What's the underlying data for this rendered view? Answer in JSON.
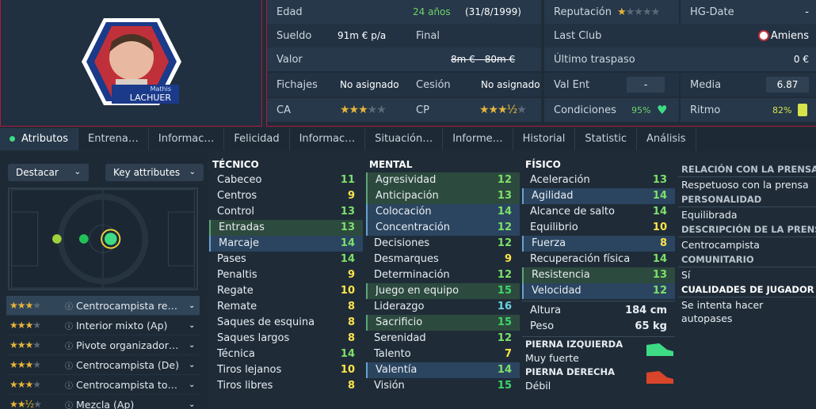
{
  "player": {
    "first": "Mathis",
    "last": "LACHUER"
  },
  "info": {
    "age_label": "Edad",
    "age": "24 años",
    "birth": "(31/8/1999)",
    "wage_label": "Sueldo",
    "wage": "91m € p/a",
    "final_label": "Final",
    "value_label": "Valor",
    "value": "8m € - 80m €",
    "signings_label": "Fichajes",
    "signings": "No asignado",
    "cesion_label": "Cesión",
    "cesion": "No asignado",
    "ca_label": "CA",
    "cp_label": "CP",
    "rep_label": "Reputación",
    "hg_label": "HG-Date",
    "hg": "-",
    "lastclub_label": "Last Club",
    "lastclub": "Amiens",
    "transfer_label": "Último traspaso",
    "transfer": "0 €",
    "valent_label": "Val Ent",
    "valent": "-",
    "media_label": "Media",
    "media": "6.87",
    "cond_label": "Condiciones",
    "cond": "95%",
    "ritmo_label": "Ritmo",
    "ritmo": "82%"
  },
  "tabs": [
    "Atributos",
    "Entrena…",
    "Informac…",
    "Felicidad",
    "Informac…",
    "Situación…",
    "Informe…",
    "Historial",
    "Statistic",
    "Análisis"
  ],
  "left": {
    "highlight": "Destacar",
    "key": "Key attributes"
  },
  "roles": [
    {
      "name": "Centrocampista re…",
      "stars": 3,
      "half": false
    },
    {
      "name": "Interior mixto (Ap)",
      "stars": 3,
      "half": false
    },
    {
      "name": "Pivote organizador…",
      "stars": 3,
      "half": false
    },
    {
      "name": "Centrocampista (De)",
      "stars": 3,
      "half": false
    },
    {
      "name": "Centrocampista to…",
      "stars": 3,
      "half": false
    },
    {
      "name": "Mezcla (Ap)",
      "stars": 2,
      "half": true
    }
  ],
  "tecnico": {
    "title": "TÉCNICO",
    "items": [
      [
        "Cabeceo",
        11
      ],
      [
        "Centros",
        9
      ],
      [
        "Control",
        13
      ],
      [
        "Entradas",
        13
      ],
      [
        "Marcaje",
        14
      ],
      [
        "Pases",
        14
      ],
      [
        "Penaltis",
        9
      ],
      [
        "Regate",
        10
      ],
      [
        "Remate",
        8
      ],
      [
        "Saques de esquina",
        8
      ],
      [
        "Saques largos",
        8
      ],
      [
        "Técnica",
        14
      ],
      [
        "Tiros lejanos",
        10
      ],
      [
        "Tiros libres",
        8
      ]
    ]
  },
  "mental": {
    "title": "MENTAL",
    "items": [
      [
        "Agresividad",
        12
      ],
      [
        "Anticipación",
        13
      ],
      [
        "Colocación",
        14
      ],
      [
        "Concentración",
        12
      ],
      [
        "Decisiones",
        12
      ],
      [
        "Desmarques",
        9
      ],
      [
        "Determinación",
        12
      ],
      [
        "Juego en equipo",
        15
      ],
      [
        "Liderazgo",
        16
      ],
      [
        "Sacrificio",
        15
      ],
      [
        "Serenidad",
        12
      ],
      [
        "Talento",
        7
      ],
      [
        "Valentía",
        14
      ],
      [
        "Visión",
        15
      ]
    ]
  },
  "fisico": {
    "title": "FÍSICO",
    "items": [
      [
        "Aceleración",
        13
      ],
      [
        "Agilidad",
        14
      ],
      [
        "Alcance de salto",
        14
      ],
      [
        "Equilibrio",
        10
      ],
      [
        "Fuerza",
        8
      ],
      [
        "Recuperación física",
        14
      ],
      [
        "Resistencia",
        13
      ],
      [
        "Velocidad",
        12
      ]
    ],
    "height_label": "Altura",
    "height": "184 cm",
    "weight_label": "Peso",
    "weight": "65 kg",
    "left_foot_label": "PIERNA IZQUIERDA",
    "left_foot": "Muy fuerte",
    "right_foot_label": "PIERNA DERECHA",
    "right_foot": "Débil"
  },
  "side": {
    "press_h": "RELACIÓN CON LA PRENSA",
    "press": "Respetuoso con la prensa",
    "pers_h": "PERSONALIDAD",
    "pers": "Equilibrada",
    "desc_h": "DESCRIPCIÓN DE LA PRENSA",
    "desc": "Centrocampista",
    "com_h": "COMUNITARIO",
    "com": "Sí",
    "qual_h": "CUALIDADES DE JUGADOR",
    "qual1": "Se intenta hacer",
    "qual2": "autopases"
  },
  "colors": {
    "accent": "#b01a3a",
    "good": "#3ddc84"
  }
}
